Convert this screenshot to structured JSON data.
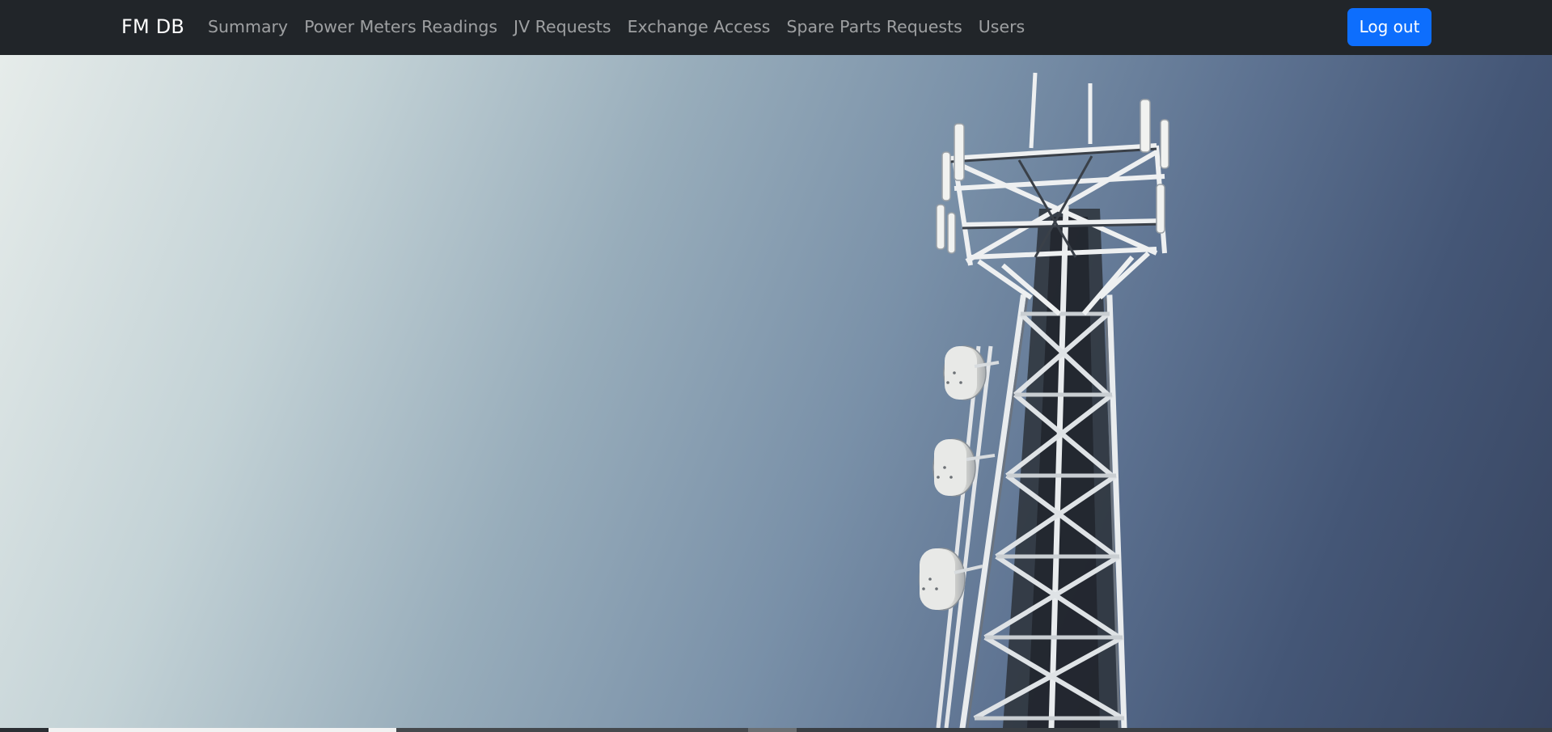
{
  "navbar": {
    "brand": "FM DB",
    "links": [
      {
        "label": "Summary"
      },
      {
        "label": "Power Meters Readings"
      },
      {
        "label": "JV Requests"
      },
      {
        "label": "Exchange Access"
      },
      {
        "label": "Spare Parts Requests"
      },
      {
        "label": "Users"
      }
    ],
    "logout_label": "Log out"
  },
  "hero": {
    "image_subject": "telecom-tower-icon"
  },
  "colors": {
    "navbar_bg": "#212529",
    "primary_button": "#0d6efd",
    "sky_light": "#e6ecea",
    "sky_dark": "#37445f"
  }
}
